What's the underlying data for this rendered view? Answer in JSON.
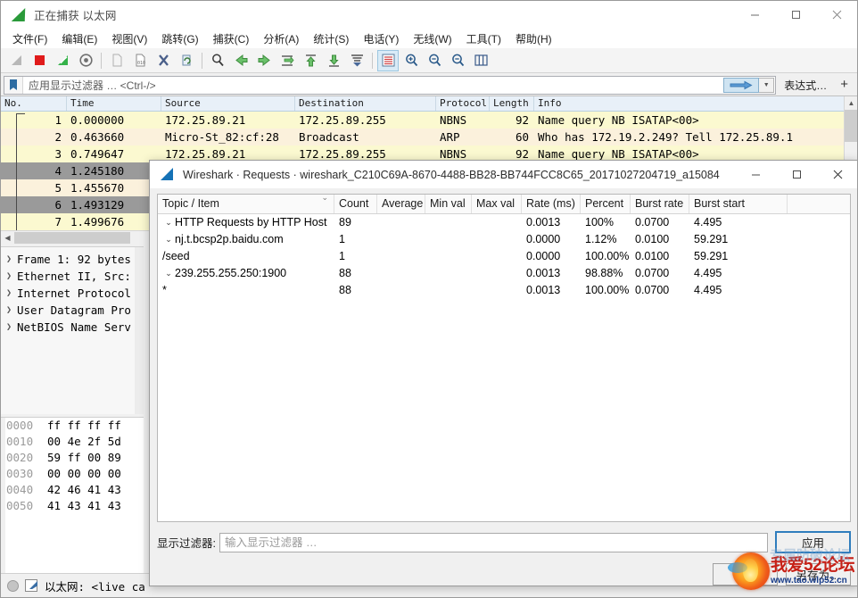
{
  "window": {
    "title": "正在捕获 以太网",
    "icon": "wireshark-fin-icon",
    "minimize_label": "—",
    "maximize_label": "□",
    "close_label": "✕"
  },
  "menu": {
    "items": [
      {
        "label": "文件(F)",
        "name": "menu-file"
      },
      {
        "label": "编辑(E)",
        "name": "menu-edit"
      },
      {
        "label": "视图(V)",
        "name": "menu-view"
      },
      {
        "label": "跳转(G)",
        "name": "menu-go"
      },
      {
        "label": "捕获(C)",
        "name": "menu-capture"
      },
      {
        "label": "分析(A)",
        "name": "menu-analyze"
      },
      {
        "label": "统计(S)",
        "name": "menu-statistics"
      },
      {
        "label": "电话(Y)",
        "name": "menu-telephony"
      },
      {
        "label": "无线(W)",
        "name": "menu-wireless"
      },
      {
        "label": "工具(T)",
        "name": "menu-tools"
      },
      {
        "label": "帮助(H)",
        "name": "menu-help"
      }
    ]
  },
  "toolbar": {
    "icons": [
      "start-capture-icon",
      "stop-capture-icon",
      "restart-capture-icon",
      "capture-options-icon",
      "open-file-icon",
      "save-file-icon",
      "close-file-icon",
      "reload-icon",
      "find-packet-icon",
      "go-back-icon",
      "go-forward-icon",
      "go-to-packet-icon",
      "go-first-packet-icon",
      "go-last-packet-icon",
      "auto-scroll-icon",
      "colorize-icon",
      "zoom-in-icon",
      "zoom-out-icon",
      "zoom-reset-icon",
      "resize-columns-icon"
    ]
  },
  "display_filter": {
    "bookmark_icon": "bookmark-icon",
    "placeholder": "应用显示过滤器 … <Ctrl-/>",
    "apply_icon": "apply-filter-arrow-icon",
    "dropdown_icon": "chevron-down-icon",
    "expression_label": "表达式…",
    "add_label": "+"
  },
  "packet_list": {
    "columns": [
      "No.",
      "Time",
      "Source",
      "Destination",
      "Protocol",
      "Length",
      "Info"
    ],
    "rows": [
      {
        "no": "1",
        "time": "0.000000",
        "src": "172.25.89.21",
        "dst": "172.25.89.255",
        "proto": "NBNS",
        "len": "92",
        "info": "Name query NB ISATAP<00>",
        "style": "nbns"
      },
      {
        "no": "2",
        "time": "0.463660",
        "src": "Micro-St_82:cf:28",
        "dst": "Broadcast",
        "proto": "ARP",
        "len": "60",
        "info": "Who has 172.19.2.249? Tell 172.25.89.1",
        "style": "arp"
      },
      {
        "no": "3",
        "time": "0.749647",
        "src": "172.25.89.21",
        "dst": "172.25.89.255",
        "proto": "NBNS",
        "len": "92",
        "info": "Name query NB ISATAP<00>",
        "style": "nbns"
      },
      {
        "no": "4",
        "time": "1.245180",
        "src": "",
        "dst": "",
        "proto": "",
        "len": "",
        "info": "",
        "style": "sel"
      },
      {
        "no": "5",
        "time": "1.455670",
        "src": "",
        "dst": "",
        "proto": "",
        "len": "",
        "info": "",
        "style": "arp"
      },
      {
        "no": "6",
        "time": "1.493129",
        "src": "",
        "dst": "",
        "proto": "",
        "len": "",
        "info": "",
        "style": "sel"
      },
      {
        "no": "7",
        "time": "1.499676",
        "src": "",
        "dst": "",
        "proto": "",
        "len": "",
        "info": "",
        "style": "nbns"
      }
    ]
  },
  "detail_tree": {
    "rows": [
      {
        "label": "Frame 1: 92 bytes",
        "arrow": "chevron-right-icon"
      },
      {
        "label": "Ethernet II, Src:",
        "arrow": "chevron-right-icon"
      },
      {
        "label": "Internet Protocol",
        "arrow": "chevron-right-icon"
      },
      {
        "label": "User Datagram Pro",
        "arrow": "chevron-right-icon"
      },
      {
        "label": "NetBIOS Name Serv",
        "arrow": "chevron-right-icon"
      }
    ]
  },
  "hex_pane": {
    "rows": [
      {
        "offset": "0000",
        "bytes": "ff ff ff ff"
      },
      {
        "offset": "0010",
        "bytes": "00 4e 2f 5d"
      },
      {
        "offset": "0020",
        "bytes": "59 ff 00 89"
      },
      {
        "offset": "0030",
        "bytes": "00 00 00 00"
      },
      {
        "offset": "0040",
        "bytes": "42 46 41 43"
      },
      {
        "offset": "0050",
        "bytes": "41 43 41 43"
      }
    ]
  },
  "status_bar": {
    "record_icon": "record-circle-icon",
    "file_icon": "capture-file-icon",
    "text": "以太网: <live ca"
  },
  "dialog": {
    "icon": "wireshark-fin-icon",
    "title": "Wireshark · Requests · wireshark_C210C69A-8670-4488-BB28-BB744FCC8C65_20171027204719_a15084",
    "minimize_label": "—",
    "maximize_label": "□",
    "close_label": "✕",
    "columns": [
      "Topic / Item",
      "Count",
      "Average",
      "Min val",
      "Max val",
      "Rate (ms)",
      "Percent",
      "Burst rate",
      "Burst start"
    ],
    "sort_indicator": "chevron-down-icon",
    "rows": [
      {
        "topic": "HTTP Requests by HTTP Host",
        "indent": 0,
        "chevron": "chevron-down-icon",
        "count": "89",
        "average": "",
        "min": "",
        "max": "",
        "rate": "0.0013",
        "percent": "100%",
        "burst_rate": "0.0700",
        "burst_start": "4.495"
      },
      {
        "topic": "nj.t.bcsp2p.baidu.com",
        "indent": 1,
        "chevron": "chevron-down-icon",
        "count": "1",
        "average": "",
        "min": "",
        "max": "",
        "rate": "0.0000",
        "percent": "1.12%",
        "burst_rate": "0.0100",
        "burst_start": "59.291"
      },
      {
        "topic": "/seed",
        "indent": 2,
        "chevron": "",
        "count": "1",
        "average": "",
        "min": "",
        "max": "",
        "rate": "0.0000",
        "percent": "100.00%",
        "burst_rate": "0.0100",
        "burst_start": "59.291"
      },
      {
        "topic": "239.255.255.250:1900",
        "indent": 1,
        "chevron": "chevron-down-icon",
        "count": "88",
        "average": "",
        "min": "",
        "max": "",
        "rate": "0.0013",
        "percent": "98.88%",
        "burst_rate": "0.0700",
        "burst_start": "4.495"
      },
      {
        "topic": "*",
        "indent": 2,
        "chevron": "",
        "count": "88",
        "average": "",
        "min": "",
        "max": "",
        "rate": "0.0013",
        "percent": "100.00%",
        "burst_rate": "0.0700",
        "burst_start": "4.495"
      }
    ],
    "filter_label": "显示过滤器:",
    "filter_placeholder": "输入显示过滤器 …",
    "apply_label": "应用",
    "copy_label": "复制",
    "saveas_label": "另存为…"
  },
  "watermark": {
    "main_text": "我爱52论坛",
    "url_text": "www.tao.wlp52.cn",
    "ghost_text": "专属防破论坛",
    "logo": "flame-logo-icon"
  },
  "colors": {
    "nbns_row": "#fbf9d0",
    "arp_row": "#fbf1dc",
    "selected_row": "#9a9a9a",
    "header_blue": "#e8f0f8",
    "accent_blue": "#2f7dbd"
  }
}
